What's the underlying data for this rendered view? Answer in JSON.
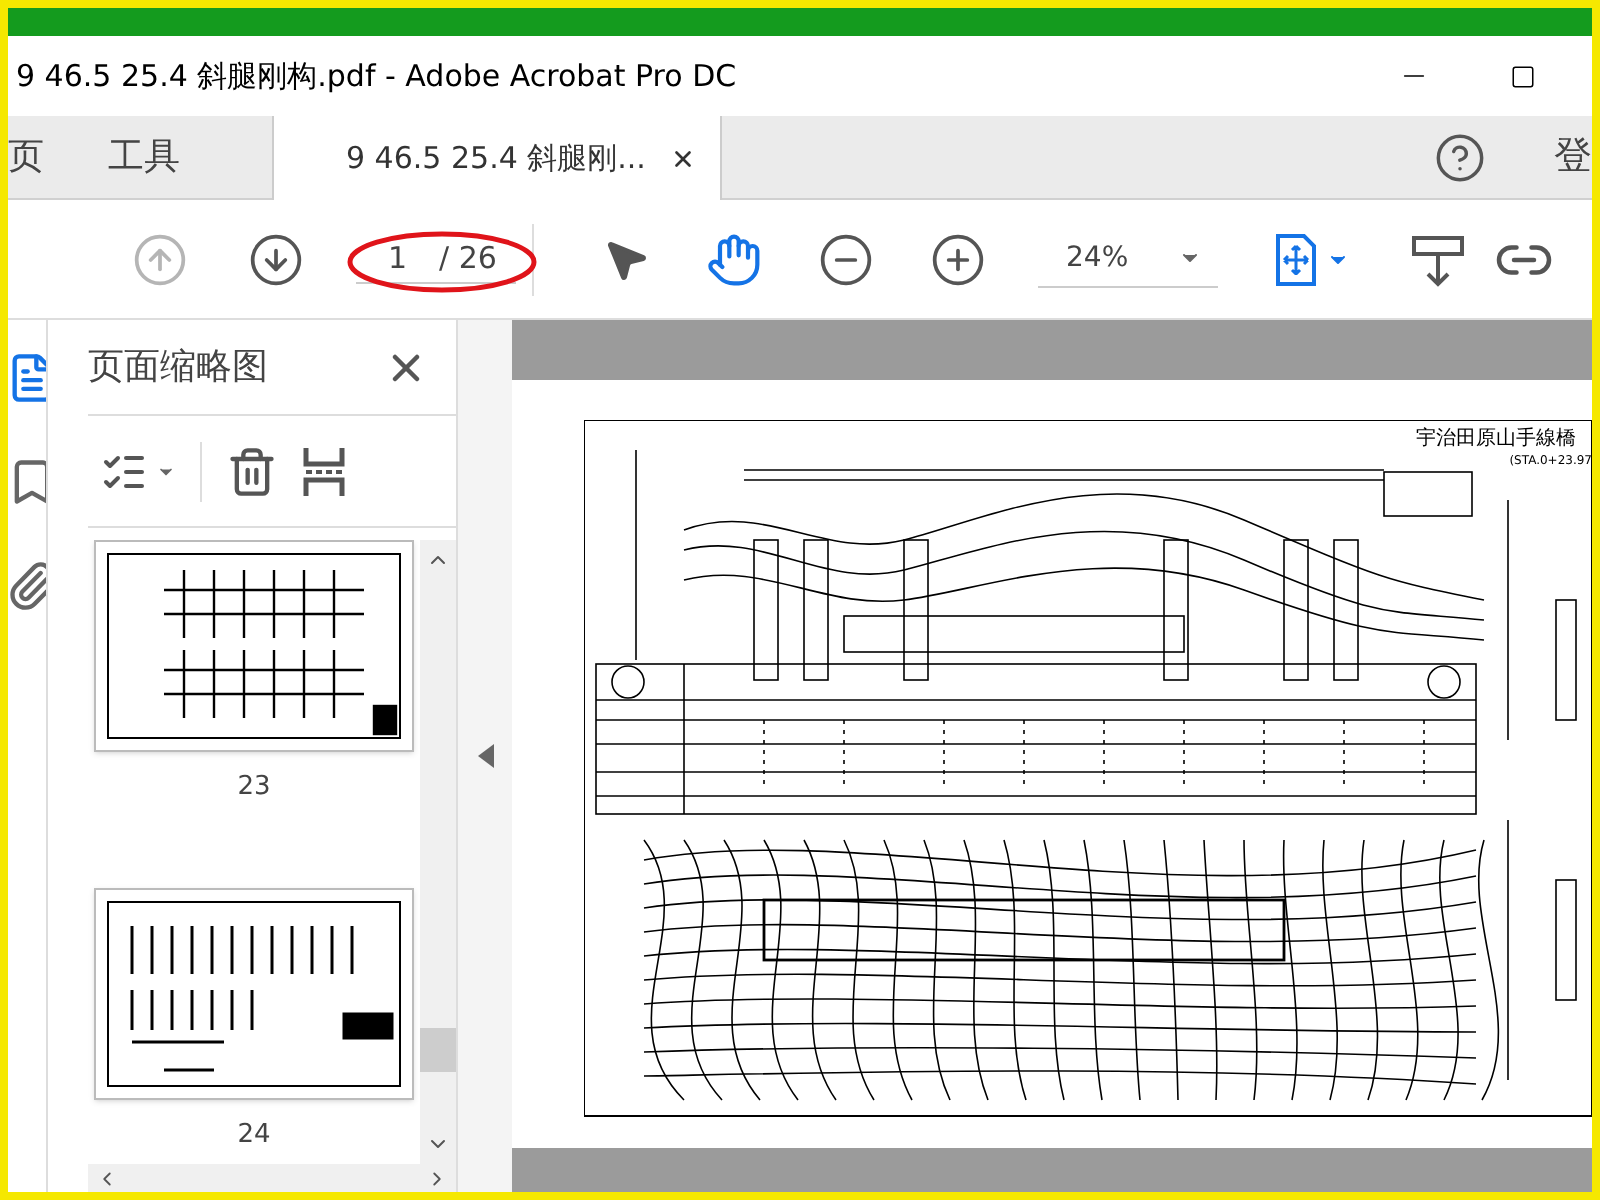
{
  "window": {
    "title": "9 46.5 25.4 斜腿刚构.pdf - Adobe Acrobat Pro DC"
  },
  "tabs": [
    {
      "label": "页",
      "selected": false
    },
    {
      "label": "工具",
      "selected": false
    },
    {
      "label": "9 46.5 25.4 斜腿刚...",
      "selected": true
    }
  ],
  "account": {
    "label": "登"
  },
  "toolbar": {
    "nav_buttons": [
      {
        "disabled": true
      },
      {
        "disabled": false
      }
    ],
    "page": {
      "current": "1",
      "total": "/ 26"
    },
    "zoom": "24%"
  },
  "sidebar": {
    "title": "页面缩略图",
    "thumbnails": [
      {
        "label": "23"
      },
      {
        "label": "24"
      }
    ]
  },
  "document": {
    "title": "宇治田原山手線橋",
    "subtitle": "(STA.0+23.97"
  }
}
